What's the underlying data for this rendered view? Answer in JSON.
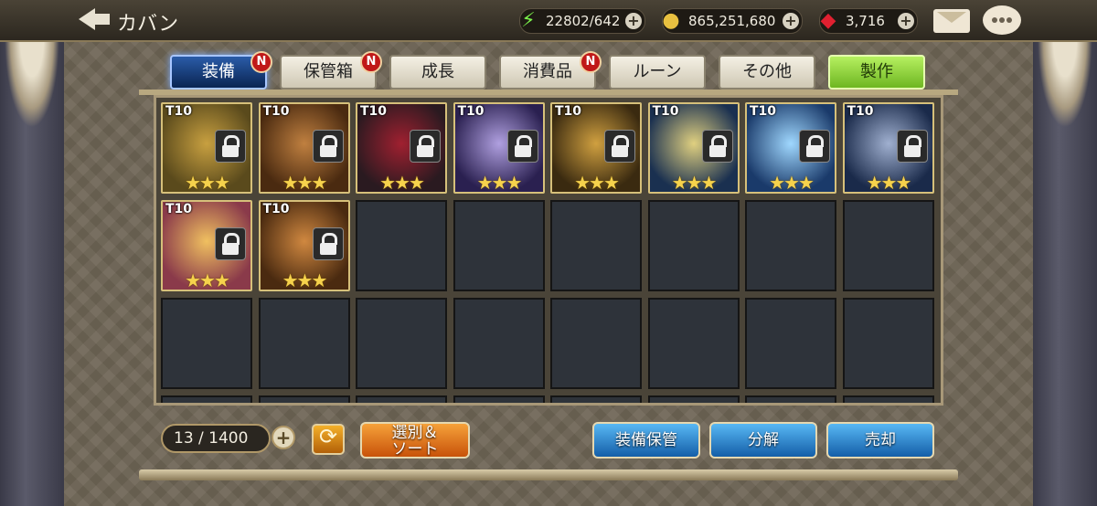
{
  "header": {
    "title": "カバン",
    "stamina": "22802/642",
    "gold": "865,251,680",
    "gems": "3,716"
  },
  "tabs": [
    {
      "label": "装備",
      "badge": "N"
    },
    {
      "label": "保管箱",
      "badge": "N"
    },
    {
      "label": "成長",
      "badge": ""
    },
    {
      "label": "消費品",
      "badge": "N"
    },
    {
      "label": "ルーン",
      "badge": ""
    },
    {
      "label": "その他",
      "badge": ""
    },
    {
      "label": "製作",
      "badge": ""
    }
  ],
  "inventory": {
    "items": [
      {
        "tier": "T10",
        "stars": 3,
        "locked": true,
        "colors": [
          "#5a4a1c",
          "#c8a040"
        ]
      },
      {
        "tier": "T10",
        "stars": 3,
        "locked": true,
        "colors": [
          "#4a2a10",
          "#c08040"
        ]
      },
      {
        "tier": "T10",
        "stars": 3,
        "locked": true,
        "colors": [
          "#2a1a20",
          "#a02030"
        ]
      },
      {
        "tier": "T10",
        "stars": 3,
        "locked": true,
        "colors": [
          "#2a2050",
          "#b0a0e0"
        ]
      },
      {
        "tier": "T10",
        "stars": 3,
        "locked": true,
        "colors": [
          "#3a2a10",
          "#d0a040"
        ]
      },
      {
        "tier": "T10",
        "stars": 3,
        "locked": true,
        "colors": [
          "#1a3050",
          "#e0d080"
        ]
      },
      {
        "tier": "T10",
        "stars": 3,
        "locked": true,
        "colors": [
          "#1a3a6a",
          "#a0d8ff"
        ]
      },
      {
        "tier": "T10",
        "stars": 3,
        "locked": true,
        "colors": [
          "#1a2a4a",
          "#a0b0d0"
        ]
      },
      {
        "tier": "T10",
        "stars": 3,
        "locked": true,
        "colors": [
          "#8a3a4a",
          "#f0c060"
        ]
      },
      {
        "tier": "T10",
        "stars": 3,
        "locked": true,
        "colors": [
          "#4a2a10",
          "#d08840"
        ]
      }
    ],
    "count": "13 / 1400"
  },
  "actions": {
    "sort_label": "選別＆ ソート",
    "store_label": "装備保管",
    "dismantle_label": "分解",
    "sell_label": "売却"
  }
}
